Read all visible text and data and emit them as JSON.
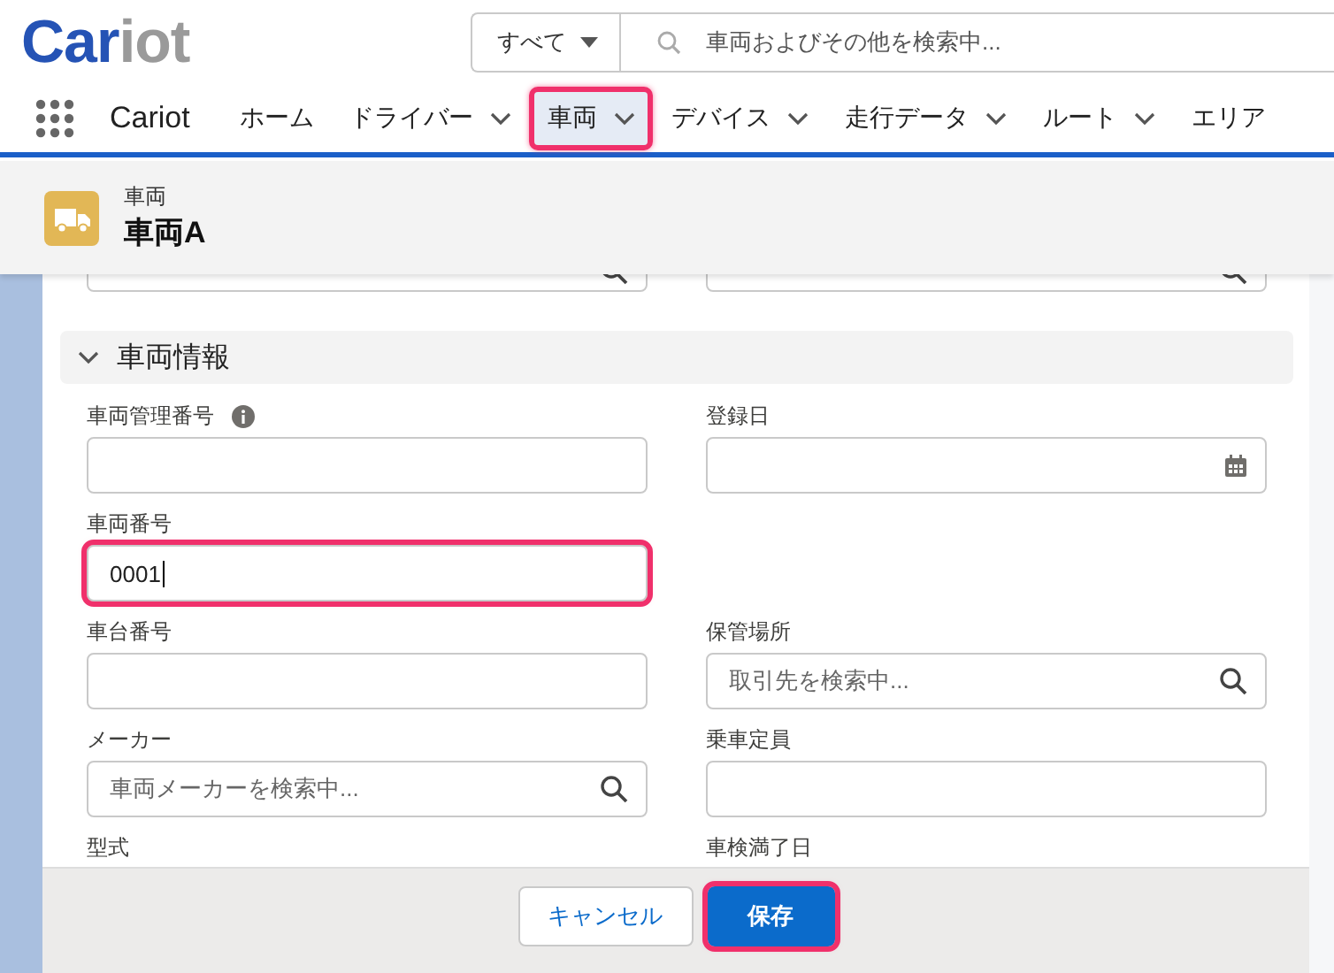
{
  "logo": [
    "Car",
    "iot"
  ],
  "search": {
    "scope": "すべて",
    "placeholder": "車両およびその他を検索中..."
  },
  "app_name": "Cariot",
  "nav": [
    {
      "label": "ホーム",
      "menu": false,
      "selected": false,
      "highlighted": false
    },
    {
      "label": "ドライバー",
      "menu": true,
      "selected": false,
      "highlighted": false
    },
    {
      "label": "車両",
      "menu": true,
      "selected": true,
      "highlighted": true
    },
    {
      "label": "デバイス",
      "menu": true,
      "selected": false,
      "highlighted": false
    },
    {
      "label": "走行データ",
      "menu": true,
      "selected": false,
      "highlighted": false
    },
    {
      "label": "ルート",
      "menu": true,
      "selected": false,
      "highlighted": false
    },
    {
      "label": "エリア",
      "menu": false,
      "selected": false,
      "highlighted": false
    }
  ],
  "record": {
    "type": "車両",
    "title": "車両A"
  },
  "top_fields": [
    {
      "kind": "lookup"
    },
    {
      "kind": "lookup"
    }
  ],
  "section": {
    "title": "車両情報",
    "expanded": true
  },
  "rows": [
    [
      {
        "label": "車両管理番号",
        "kind": "text",
        "info": true,
        "highlighted": false
      },
      {
        "label": "登録日",
        "kind": "date",
        "info": false,
        "highlighted": false
      }
    ],
    [
      {
        "label": "車両番号",
        "kind": "text",
        "value": "0001",
        "focused": true,
        "highlighted": true
      },
      {
        "kind": "empty"
      }
    ],
    [
      {
        "label": "車台番号",
        "kind": "text",
        "info": false,
        "highlighted": false
      },
      {
        "label": "保管場所",
        "kind": "lookup",
        "placeholder": "取引先を検索中...",
        "info": false,
        "highlighted": false
      }
    ],
    [
      {
        "label": "メーカー",
        "kind": "lookup",
        "placeholder": "車両メーカーを検索中...",
        "info": false,
        "highlighted": false
      },
      {
        "label": "乗車定員",
        "kind": "text",
        "info": false,
        "highlighted": false
      }
    ],
    [
      {
        "label": "型式",
        "kind": "text",
        "covered": true
      },
      {
        "label": "車検満了日",
        "kind": "date",
        "covered": true
      }
    ]
  ],
  "buttons": [
    {
      "label": "キャンセル",
      "kind": "neutral",
      "highlighted": false
    },
    {
      "label": "保存",
      "kind": "brand",
      "highlighted": true
    }
  ]
}
